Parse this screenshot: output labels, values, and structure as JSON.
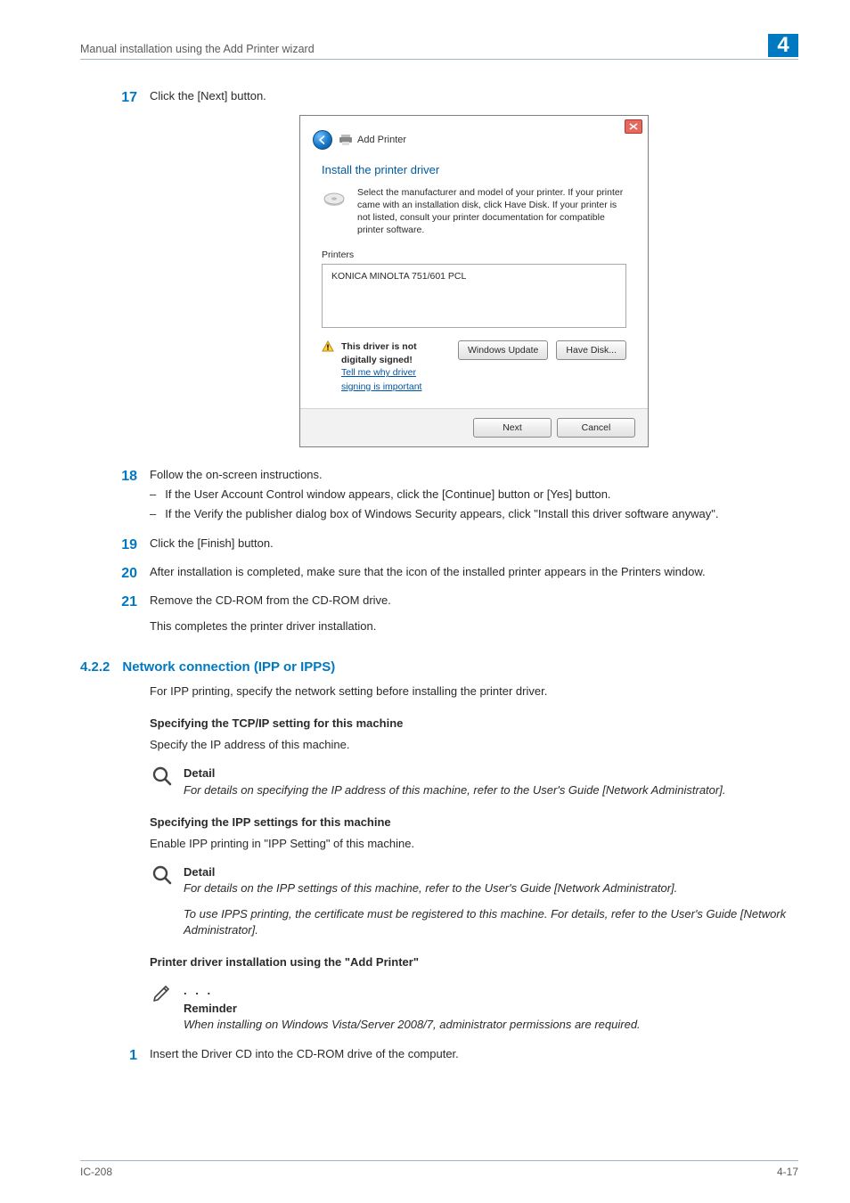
{
  "header": {
    "running_title": "Manual installation using the Add Printer wizard",
    "chapter": "4"
  },
  "footer": {
    "left": "IC-208",
    "right": "4-17"
  },
  "steps": {
    "s17": {
      "num": "17",
      "text": "Click the [Next] button."
    },
    "s18": {
      "num": "18",
      "text": "Follow the on-screen instructions.",
      "subs": [
        "If the User Account Control window appears, click the [Continue] button or [Yes] button.",
        "If the Verify the publisher dialog box of Windows Security appears, click \"Install this driver software anyway\"."
      ]
    },
    "s19": {
      "num": "19",
      "text": "Click the [Finish] button."
    },
    "s20": {
      "num": "20",
      "text": "After installation is completed, make sure that the icon of the installed printer appears in the Printers window."
    },
    "s21": {
      "num": "21",
      "text": "Remove the CD-ROM from the CD-ROM drive.",
      "tail": "This completes the printer driver installation."
    },
    "s1": {
      "num": "1",
      "text": "Insert the Driver CD into the CD-ROM drive of the computer."
    }
  },
  "section": {
    "num": "4.2.2",
    "title": "Network connection (IPP or IPPS)",
    "intro": "For IPP printing, specify the network setting before installing the printer driver."
  },
  "tcpip": {
    "heading": "Specifying the TCP/IP setting for this machine",
    "body": "Specify the IP address of this machine.",
    "note_label": "Detail",
    "note_text": "For details on specifying the IP address of this machine, refer to the User's Guide [Network Administrator]."
  },
  "ipp": {
    "heading": "Specifying the IPP settings for this machine",
    "body": "Enable IPP printing in \"IPP Setting\" of this machine.",
    "note_label": "Detail",
    "note_text1": "For details on the IPP settings of this machine, refer to the User's Guide [Network Administrator].",
    "note_text2": "To use IPPS printing, the certificate must be registered to this machine. For details, refer to the User's Guide [Network Administrator]."
  },
  "addprinter": {
    "heading": "Printer driver installation using the \"Add Printer\"",
    "note_label": "Reminder",
    "note_text": "When installing on Windows Vista/Server 2008/7, administrator permissions are required."
  },
  "dialog": {
    "title": "Add Printer",
    "instruction": "Install the printer driver",
    "desc": "Select the manufacturer and model of your printer. If your printer came with an installation disk, click Have Disk. If your printer is not listed, consult your printer documentation for compatible printer software.",
    "list_header": "Printers",
    "list_item": "KONICA MINOLTA 751/601 PCL",
    "signing_warn": "This driver is not digitally signed!",
    "signing_link": "Tell me why driver signing is important",
    "btn_update": "Windows Update",
    "btn_disk": "Have Disk...",
    "btn_next": "Next",
    "btn_cancel": "Cancel"
  }
}
